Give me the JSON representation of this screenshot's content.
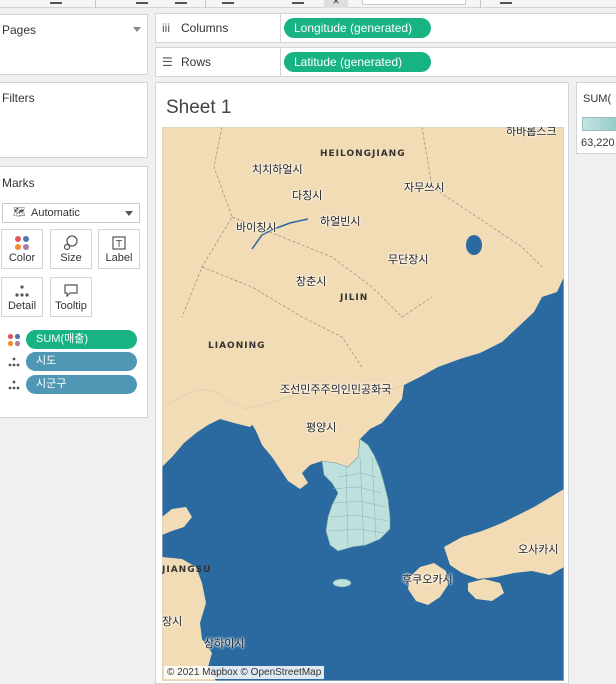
{
  "panels": {
    "pages": {
      "title": "Pages"
    },
    "filters": {
      "title": "Filters"
    },
    "marks": {
      "title": "Marks",
      "mark_type": "Automatic",
      "buttons": [
        {
          "label": "Color",
          "icon": "color-icon"
        },
        {
          "label": "Size",
          "icon": "size-icon"
        },
        {
          "label": "Label",
          "icon": "label-icon"
        },
        {
          "label": "Detail",
          "icon": "detail-icon"
        },
        {
          "label": "Tooltip",
          "icon": "tooltip-icon"
        }
      ],
      "fields": [
        {
          "label": "SUM(매출)",
          "type": "color"
        },
        {
          "label": "시도",
          "type": "detail"
        },
        {
          "label": "시군구",
          "type": "detail"
        }
      ]
    }
  },
  "shelves": {
    "columns": {
      "label": "Columns",
      "pill": "Longitude (generated)"
    },
    "rows": {
      "label": "Rows",
      "pill": "Latitude (generated)"
    }
  },
  "sheet": {
    "title": "Sheet 1"
  },
  "map": {
    "labels": {
      "harbin_top": "하바롭스크",
      "qiqihar": "치치하얼시",
      "heilongjiang": "HEILONGJIANG",
      "daqing": "다칭시",
      "jiamusi": "자무쓰시",
      "yichun": "바이칭시",
      "harbin": "하얼빈시",
      "mudanjiang": "무단장시",
      "changchun": "창춘시",
      "jilin": "JILIN",
      "liaoning": "LIAONING",
      "dprk": "조선민주주의인민공화국",
      "pyongyang": "평양시",
      "osaka": "오사카시",
      "fukuoka": "후쿠오카시",
      "jiangsu": "JIANGSU",
      "shanghai_small": "장시",
      "shanghai": "상하이시"
    },
    "credit": "© 2021 Mapbox © OpenStreetMap"
  },
  "legend": {
    "title": "SUM(",
    "value": "63,220"
  },
  "colors": {
    "accent_green": "#18b383",
    "pill_blue": "#4f97b5",
    "water": "#2a6aa0",
    "land": "#f2dcb5",
    "korea": "#bfe0dd"
  }
}
